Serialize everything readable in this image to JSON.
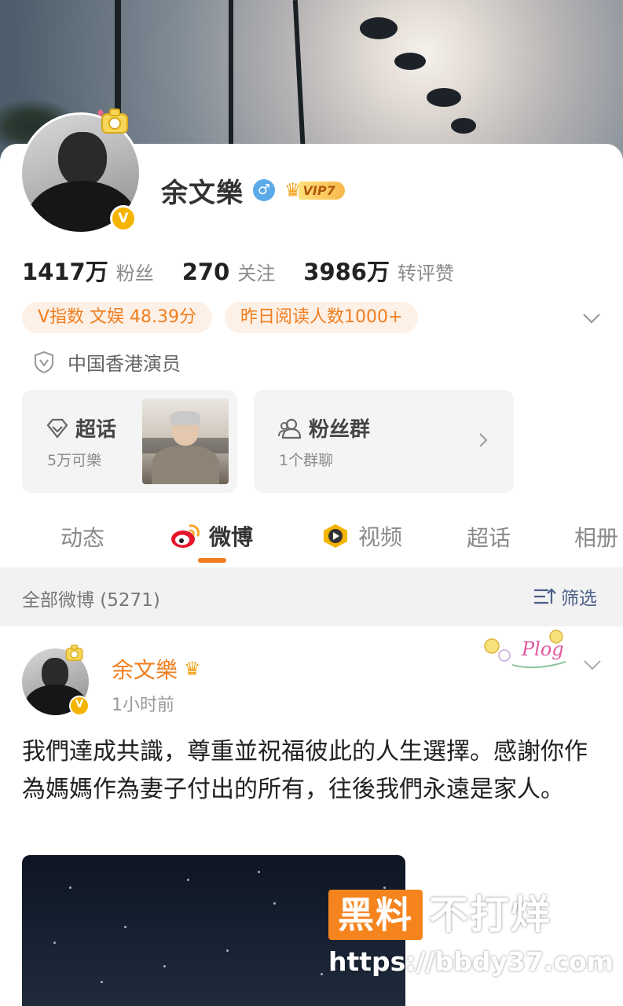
{
  "profile": {
    "name": "余文樂",
    "gender_symbol": "♂",
    "vip_label": "VIP7",
    "verified_mark": "V",
    "stats": [
      {
        "value": "1417万",
        "label": "粉丝"
      },
      {
        "value": "270",
        "label": "关注"
      },
      {
        "value": "3986万",
        "label": "转评赞"
      }
    ],
    "pills": [
      "V指数 文娱 48.39分",
      "昨日阅读人数1000+"
    ],
    "certification": "中国香港演员",
    "accent_color": "#f07e1f"
  },
  "cards": {
    "chaohua": {
      "title": "超话",
      "subtitle": "5万可樂"
    },
    "fans_group": {
      "title": "粉丝群",
      "subtitle": "1个群聊"
    }
  },
  "tabs": [
    {
      "label": "动态",
      "active": false
    },
    {
      "label": "微博",
      "active": true,
      "icon": "weibo-icon"
    },
    {
      "label": "视频",
      "active": false,
      "icon": "video-icon"
    },
    {
      "label": "超话",
      "active": false
    },
    {
      "label": "相册",
      "active": false
    }
  ],
  "filter": {
    "count_label": "全部微博 (5271)",
    "button_label": "筛选"
  },
  "post": {
    "author": "余文樂",
    "time": "1小时前",
    "text": "我們達成共識，尊重並祝福彼此的人生選擇。感謝你作為媽媽作為妻子付出的所有，往後我們永遠是家人。",
    "sticker_label": "Plog"
  },
  "watermark": {
    "box_text": "黑料",
    "text": "不打烊",
    "url": "https://bbdy37.com"
  }
}
